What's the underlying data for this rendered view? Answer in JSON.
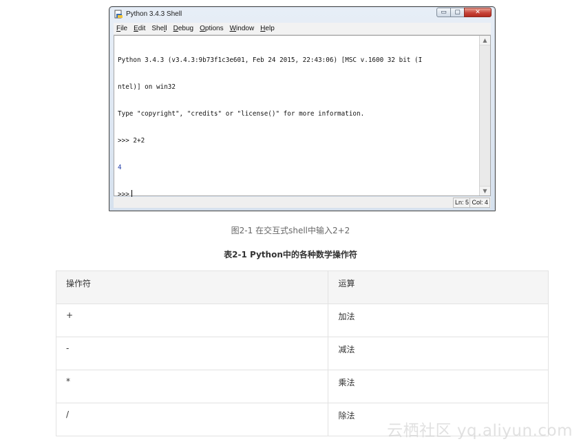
{
  "window": {
    "title": "Python 3.4.3 Shell",
    "controls": {
      "minimize": "▭",
      "maximize": "▢",
      "close": "✕"
    },
    "menu": [
      {
        "accel": "F",
        "rest": "ile"
      },
      {
        "accel": "E",
        "rest": "dit"
      },
      {
        "pre": "She",
        "accel": "l",
        "rest": "l"
      },
      {
        "accel": "D",
        "rest": "ebug"
      },
      {
        "accel": "O",
        "rest": "ptions"
      },
      {
        "accel": "W",
        "rest": "indow"
      },
      {
        "accel": "H",
        "rest": "elp"
      }
    ],
    "shell_lines": [
      "Python 3.4.3 (v3.4.3:9b73f1c3e601, Feb 24 2015, 22:43:06) [MSC v.1600 32 bit (I",
      "ntel)] on win32",
      "Type \"copyright\", \"credits\" or \"license()\" for more information.",
      ">>> 2+2"
    ],
    "output_line": "4",
    "prompt": ">>>",
    "status": {
      "line": "Ln: 5",
      "col": "Col: 4"
    }
  },
  "figure_caption": "图2-1 在交互式shell中输入2+2",
  "table": {
    "title": "表2-1 Python中的各种数学操作符",
    "headers": [
      "操作符",
      "运算"
    ],
    "rows": [
      [
        "+",
        "加法"
      ],
      [
        "-",
        "减法"
      ],
      [
        "*",
        "乘法"
      ],
      [
        "/",
        "除法"
      ]
    ]
  },
  "watermark": "云栖社区 yq.aliyun.com"
}
